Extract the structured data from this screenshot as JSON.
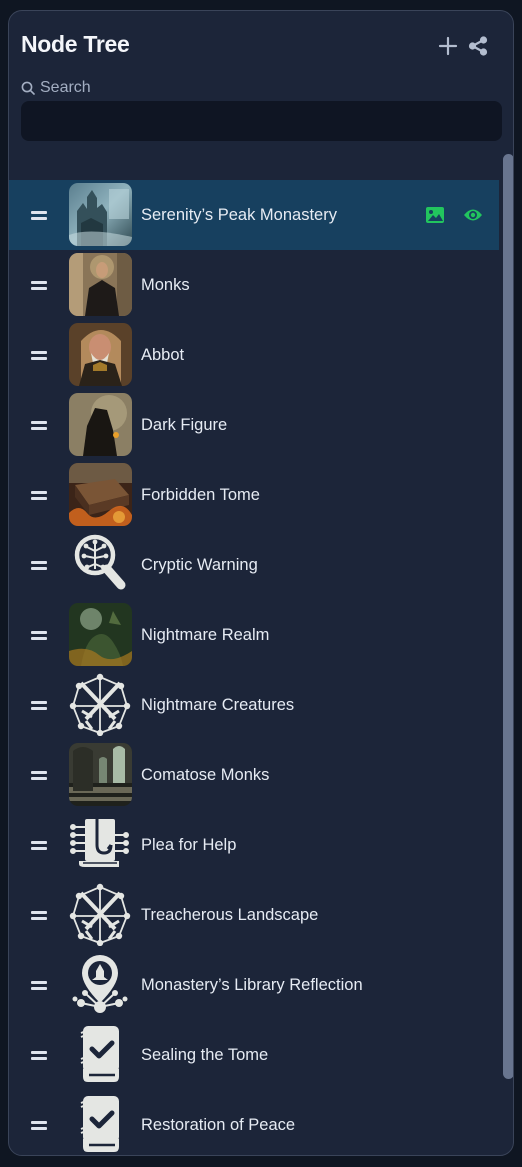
{
  "panel": {
    "title": "Node Tree",
    "add_icon": "plus-icon",
    "share_icon": "share-icon"
  },
  "search": {
    "label": "Search",
    "icon": "search-icon",
    "value": "",
    "placeholder": ""
  },
  "colors": {
    "panel_bg": "#1c2539",
    "selected_row": "#17405f",
    "accent_green": "#22c55e",
    "text": "#e6ebf3"
  },
  "nodes": [
    {
      "label": "Serenity’s Peak Monastery",
      "thumbnail": "monastery-painting",
      "selected": true,
      "actions": [
        "image-icon",
        "eye-icon"
      ]
    },
    {
      "label": "Monks",
      "thumbnail": "monk-portrait"
    },
    {
      "label": "Abbot",
      "thumbnail": "abbot-portrait"
    },
    {
      "label": "Dark Figure",
      "thumbnail": "dark-figure-painting"
    },
    {
      "label": "Forbidden Tome",
      "thumbnail": "burning-book-painting"
    },
    {
      "label": "Cryptic Warning",
      "thumbnail": "magnifier-tree-icon"
    },
    {
      "label": "Nightmare Realm",
      "thumbnail": "nightmare-realm-painting"
    },
    {
      "label": "Nightmare Creatures",
      "thumbnail": "crossed-swords-network-icon"
    },
    {
      "label": "Comatose Monks",
      "thumbnail": "cathedral-interior-painting"
    },
    {
      "label": "Plea for Help",
      "thumbnail": "book-hook-icon"
    },
    {
      "label": "Treacherous Landscape",
      "thumbnail": "crossed-swords-network-icon"
    },
    {
      "label": "Monastery’s Library Reflection",
      "thumbnail": "map-pin-network-icon"
    },
    {
      "label": "Sealing the Tome",
      "thumbnail": "book-check-icon"
    },
    {
      "label": "Restoration of Peace",
      "thumbnail": "book-check-icon"
    }
  ]
}
